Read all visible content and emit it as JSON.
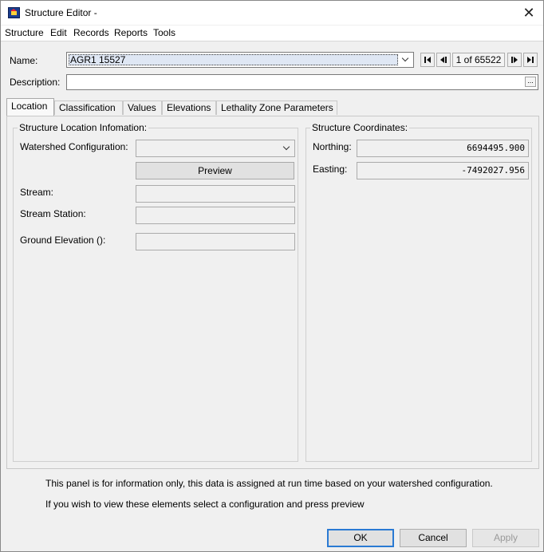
{
  "window": {
    "title": "Structure Editor -",
    "icons": {
      "app": "structure-editor-app-icon",
      "close": "close-icon"
    }
  },
  "menu": [
    "Structure",
    "Edit",
    "Records",
    "Reports",
    "Tools"
  ],
  "header": {
    "name_label": "Name:",
    "name_value": "AGR1 15527",
    "description_label": "Description:",
    "description_value": "",
    "description_button": "...",
    "record_position": "1 of 65522"
  },
  "tabs": [
    "Location",
    "Classification",
    "Values",
    "Elevations",
    "Lethality Zone Parameters"
  ],
  "location": {
    "info_group_title": "Structure Location Infomation:",
    "watershed_label": "Watershed Configuration:",
    "watershed_value": "",
    "preview_label": "Preview",
    "stream_label": "Stream:",
    "stream_value": "",
    "station_label": "Stream Station:",
    "station_value": "",
    "ground_label": "Ground Elevation ():",
    "ground_value": "",
    "coords_group_title": "Structure Coordinates:",
    "northing_label": "Northing:",
    "northing_value": "6694495.900",
    "easting_label": "Easting:",
    "easting_value": "-7492027.956"
  },
  "notes": {
    "line1": "This panel is for information only, this data is assigned at run time based on your watershed configuration.",
    "line2": "If you wish to view these elements select a configuration and press preview"
  },
  "buttons": {
    "ok": "OK",
    "cancel": "Cancel",
    "apply": "Apply"
  }
}
